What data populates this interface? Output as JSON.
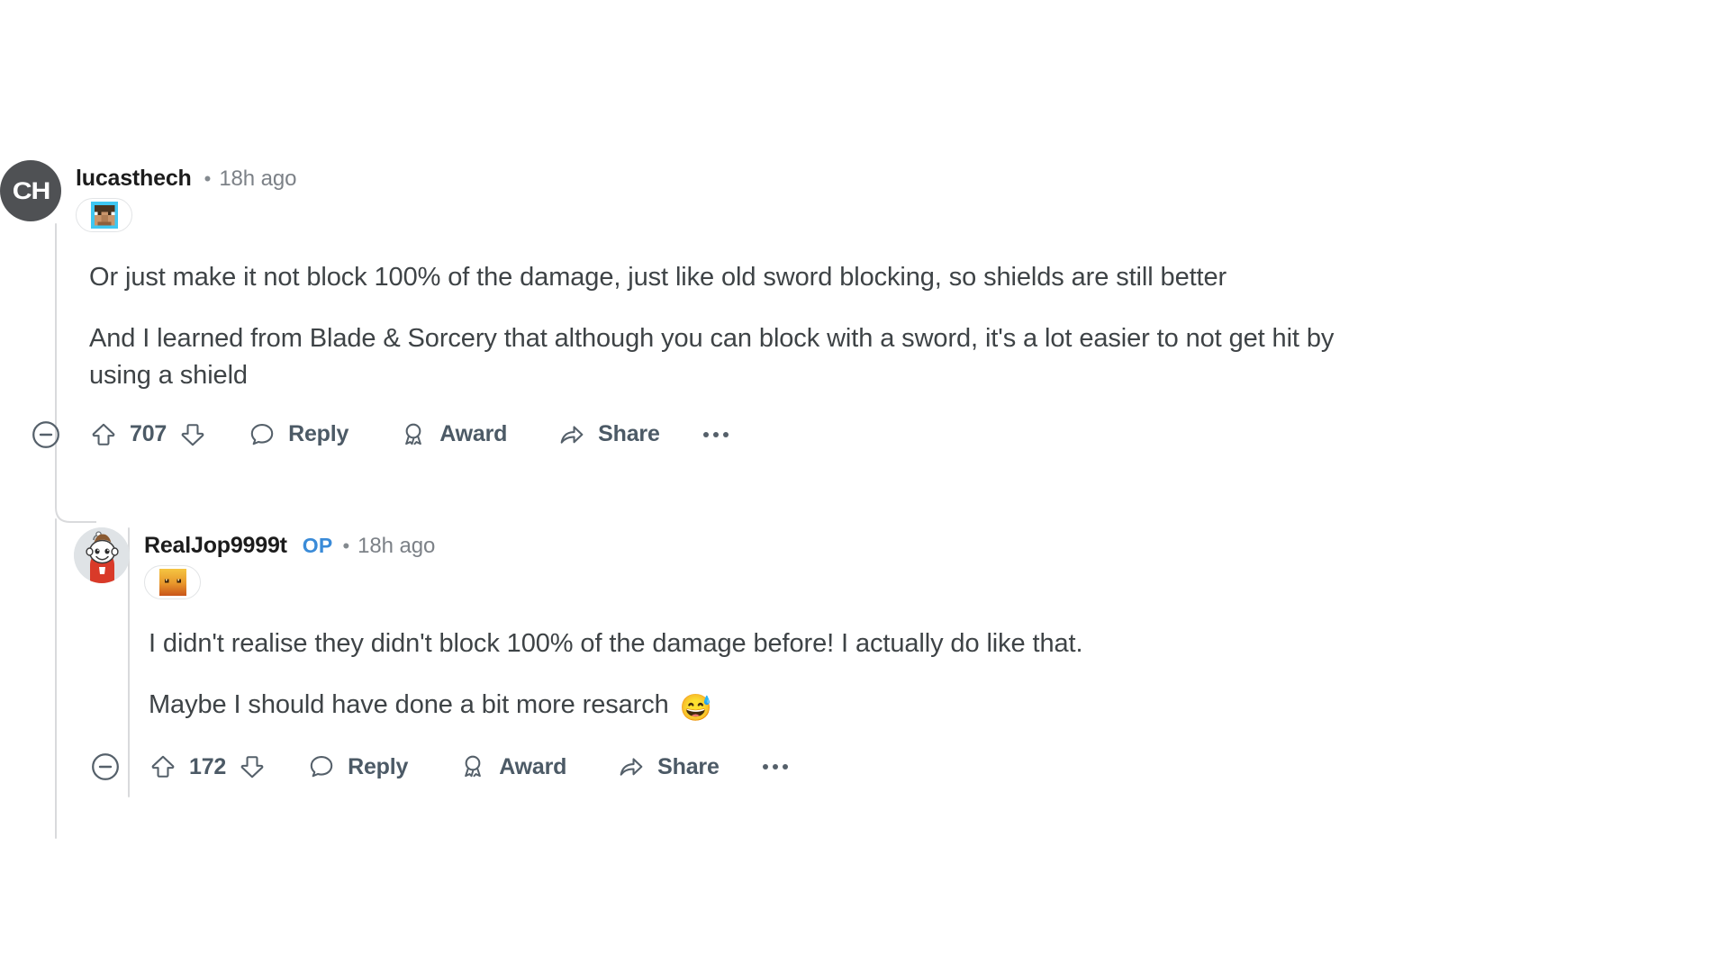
{
  "thread": {
    "comments": [
      {
        "id": "root",
        "author": "lucasthech",
        "is_op": false,
        "op_label": "",
        "separator": "•",
        "timestamp": "18h ago",
        "avatar_text": "CH",
        "avatar_kind": "initials-ch",
        "flair_icon": "minecraft-steve-head-flair",
        "paragraphs": [
          "Or just make it not block 100% of the damage, just like old sword blocking, so shields are still better",
          "And I learned from Blade & Sorcery that although you can block with a sword, it's a lot easier to not get hit by using a shield"
        ],
        "emoji": "",
        "vote_count": "707",
        "reply_label": "Reply",
        "award_label": "Award",
        "share_label": "Share"
      },
      {
        "id": "child",
        "author": "RealJop9999t",
        "is_op": true,
        "op_label": "OP",
        "separator": "•",
        "timestamp": "18h ago",
        "avatar_text": "",
        "avatar_kind": "snoo-avatar",
        "flair_icon": "minecraft-gold-block-face-flair",
        "paragraphs": [
          "I didn't realise they didn't block 100% of the damage before! I actually do like that.",
          "Maybe I should have done a bit more resarch "
        ],
        "emoji": "😅",
        "vote_count": "172",
        "reply_label": "Reply",
        "award_label": "Award",
        "share_label": "Share"
      }
    ]
  },
  "icons": {
    "collapse": "collapse-minus-circle-icon",
    "upvote": "upvote-arrow-icon",
    "downvote": "downvote-arrow-icon",
    "reply": "comment-bubble-icon",
    "award": "award-rosette-icon",
    "share": "share-arrow-icon",
    "more": "more-options-icon"
  },
  "colors": {
    "background": "#ffffff",
    "body_text": "#3e4346",
    "username": "#1c1c1c",
    "meta_text": "#7c8187",
    "op_blue": "#3a8bd8",
    "action_text": "#4c5a66",
    "thread_line": "#d9dadc",
    "avatar_root_bg": "#4f5154",
    "avatar_child_bg": "#dfe3e6"
  }
}
